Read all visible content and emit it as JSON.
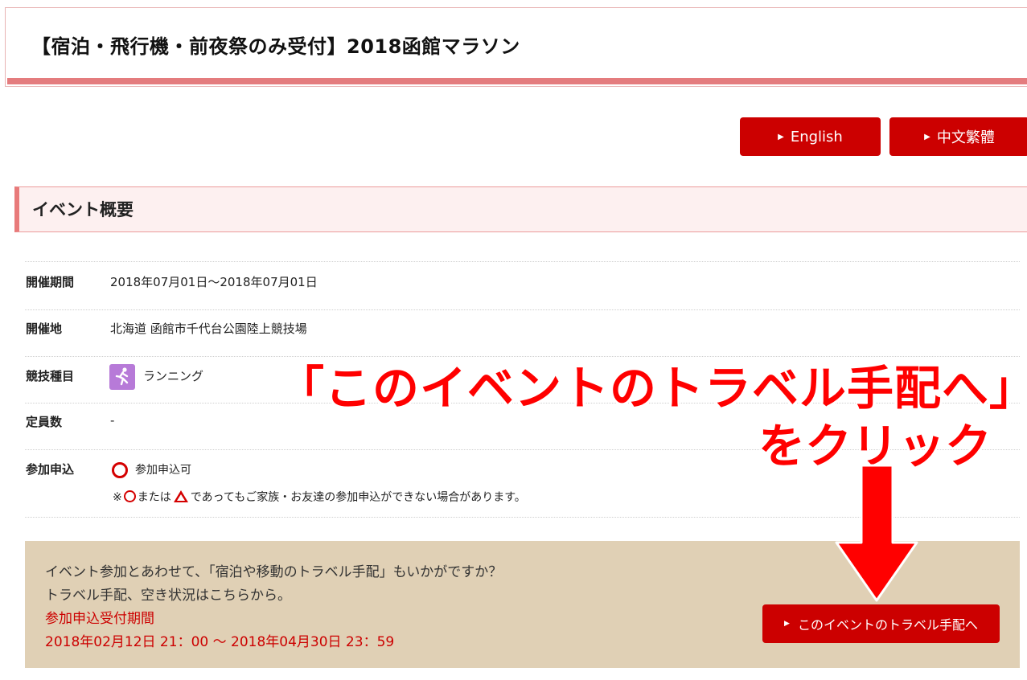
{
  "header": {
    "title": "【宿泊・飛行機・前夜祭のみ受付】2018函館マラソン"
  },
  "language_buttons": [
    {
      "label": "English"
    },
    {
      "label": "中文繁體"
    }
  ],
  "overview": {
    "heading": "イベント概要",
    "rows": [
      {
        "label": "開催期間",
        "value": "2018年07月01日～2018年07月01日"
      },
      {
        "label": "開催地",
        "value": "北海道 函館市千代台公園陸上競技場"
      },
      {
        "label": "競技種目",
        "value": "ランニング",
        "icon": "runner-icon"
      },
      {
        "label": "定員数",
        "value": "-"
      },
      {
        "label": "参加申込",
        "value": "参加申込可",
        "icon": "circle-icon"
      }
    ],
    "note": {
      "prefix": "※",
      "mid": "または",
      "suffix": "であってもご家族・お友達の参加申込ができない場合があります。"
    }
  },
  "travel": {
    "line1": "イベント参加とあわせて、「宿泊や移動のトラベル手配」もいかがですか？",
    "line2": "トラベル手配、空き状況はこちらから。",
    "period_label": "参加申込受付期間",
    "period_value": "2018年02月12日 21：00 ～ 2018年04月30日 23：59",
    "button_label": "このイベントのトラベル手配へ"
  },
  "annotation": {
    "line1": "「このイベントのトラベル手配へ」",
    "line2": "をクリック"
  },
  "colors": {
    "accent_red": "#cc0000",
    "title_bar": "#e47c7e",
    "travel_bg": "#e0d0b5",
    "callout_red": "#ff0000",
    "sport_icon_bg": "#b77ad8"
  }
}
